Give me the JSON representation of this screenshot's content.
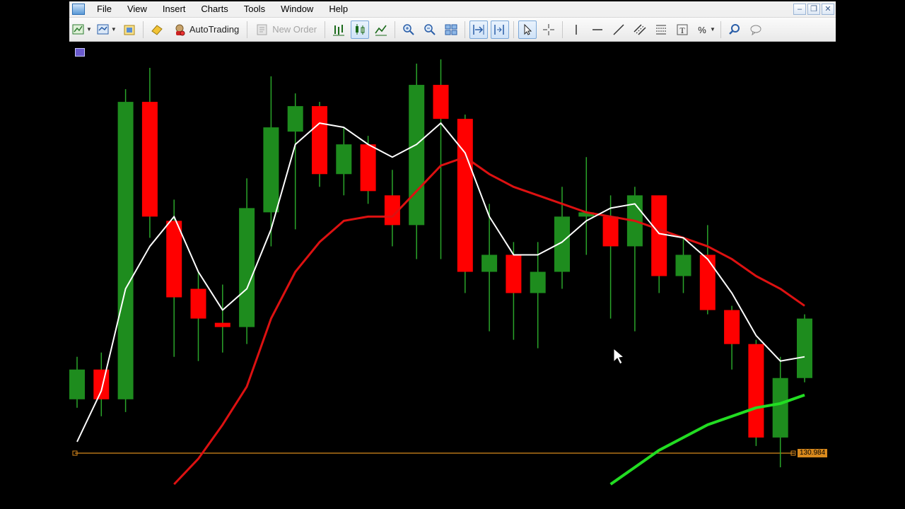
{
  "menu": {
    "items": [
      "File",
      "View",
      "Insert",
      "Charts",
      "Tools",
      "Window",
      "Help"
    ]
  },
  "window_controls": {
    "minimize": "–",
    "restore": "❐",
    "close": "✕"
  },
  "toolbar": {
    "autotrading_label": "AutoTrading",
    "new_order_label": "New Order"
  },
  "chart": {
    "price_label": "130.984",
    "colors": {
      "background": "#000000",
      "bull_candle": "#1e8c1e",
      "bear_candle": "#ff0000",
      "wick": "#2aa52a",
      "fast_ma": "#ffffff",
      "slow_ma": "#dd1111",
      "long_ma": "#22dd22",
      "horizontal_line": "#d8891d"
    }
  },
  "chart_data": {
    "type": "candlestick",
    "price_line": 130.984,
    "candles": [
      {
        "dir": "up",
        "o": 0.2,
        "c": 0.27,
        "h": 0.3,
        "l": 0.18
      },
      {
        "dir": "down",
        "o": 0.27,
        "c": 0.2,
        "h": 0.31,
        "l": 0.16
      },
      {
        "dir": "up",
        "o": 0.2,
        "c": 0.9,
        "h": 0.93,
        "l": 0.17
      },
      {
        "dir": "down",
        "o": 0.9,
        "c": 0.63,
        "h": 0.98,
        "l": 0.58
      },
      {
        "dir": "down",
        "o": 0.62,
        "c": 0.44,
        "h": 0.67,
        "l": 0.3
      },
      {
        "dir": "down",
        "o": 0.46,
        "c": 0.39,
        "h": 0.5,
        "l": 0.29
      },
      {
        "dir": "down",
        "o": 0.38,
        "c": 0.37,
        "h": 0.47,
        "l": 0.31
      },
      {
        "dir": "up",
        "o": 0.37,
        "c": 0.65,
        "h": 0.72,
        "l": 0.33
      },
      {
        "dir": "up",
        "o": 0.64,
        "c": 0.84,
        "h": 0.96,
        "l": 0.56
      },
      {
        "dir": "up",
        "o": 0.83,
        "c": 0.89,
        "h": 0.92,
        "l": 0.6
      },
      {
        "dir": "down",
        "o": 0.89,
        "c": 0.73,
        "h": 0.9,
        "l": 0.7
      },
      {
        "dir": "up",
        "o": 0.73,
        "c": 0.8,
        "h": 0.84,
        "l": 0.68
      },
      {
        "dir": "down",
        "o": 0.8,
        "c": 0.69,
        "h": 0.82,
        "l": 0.66
      },
      {
        "dir": "down",
        "o": 0.68,
        "c": 0.61,
        "h": 0.74,
        "l": 0.56
      },
      {
        "dir": "up",
        "o": 0.61,
        "c": 0.94,
        "h": 0.99,
        "l": 0.53
      },
      {
        "dir": "down",
        "o": 0.94,
        "c": 0.86,
        "h": 1.0,
        "l": 0.53
      },
      {
        "dir": "down",
        "o": 0.86,
        "c": 0.5,
        "h": 0.87,
        "l": 0.45
      },
      {
        "dir": "up",
        "o": 0.5,
        "c": 0.54,
        "h": 0.66,
        "l": 0.36
      },
      {
        "dir": "down",
        "o": 0.54,
        "c": 0.45,
        "h": 0.57,
        "l": 0.34
      },
      {
        "dir": "up",
        "o": 0.45,
        "c": 0.5,
        "h": 0.57,
        "l": 0.32
      },
      {
        "dir": "up",
        "o": 0.5,
        "c": 0.63,
        "h": 0.7,
        "l": 0.46
      },
      {
        "dir": "up",
        "o": 0.63,
        "c": 0.64,
        "h": 0.77,
        "l": 0.54
      },
      {
        "dir": "down",
        "o": 0.63,
        "c": 0.56,
        "h": 0.68,
        "l": 0.39
      },
      {
        "dir": "up",
        "o": 0.56,
        "c": 0.68,
        "h": 0.7,
        "l": 0.36
      },
      {
        "dir": "down",
        "o": 0.68,
        "c": 0.49,
        "h": 0.68,
        "l": 0.45
      },
      {
        "dir": "up",
        "o": 0.49,
        "c": 0.54,
        "h": 0.58,
        "l": 0.45
      },
      {
        "dir": "down",
        "o": 0.54,
        "c": 0.41,
        "h": 0.61,
        "l": 0.4
      },
      {
        "dir": "down",
        "o": 0.41,
        "c": 0.33,
        "h": 0.42,
        "l": 0.27
      },
      {
        "dir": "down",
        "o": 0.33,
        "c": 0.11,
        "h": 0.34,
        "l": 0.09
      },
      {
        "dir": "up",
        "o": 0.11,
        "c": 0.25,
        "h": 0.3,
        "l": 0.04
      },
      {
        "dir": "up",
        "o": 0.25,
        "c": 0.39,
        "h": 0.4,
        "l": 0.24
      }
    ],
    "fast_ma": [
      0.1,
      0.22,
      0.46,
      0.56,
      0.63,
      0.5,
      0.41,
      0.46,
      0.6,
      0.8,
      0.85,
      0.84,
      0.8,
      0.77,
      0.8,
      0.85,
      0.78,
      0.63,
      0.54,
      0.54,
      0.57,
      0.62,
      0.65,
      0.66,
      0.59,
      0.58,
      0.53,
      0.45,
      0.35,
      0.29,
      0.3
    ],
    "slow_ma": [
      null,
      null,
      null,
      null,
      0.0,
      0.06,
      0.14,
      0.23,
      0.39,
      0.5,
      0.57,
      0.62,
      0.63,
      0.63,
      0.69,
      0.75,
      0.77,
      0.73,
      0.7,
      0.68,
      0.66,
      0.64,
      0.63,
      0.62,
      0.6,
      0.58,
      0.56,
      0.53,
      0.49,
      0.46,
      0.42
    ],
    "long_ma": [
      null,
      null,
      null,
      null,
      null,
      null,
      null,
      null,
      null,
      null,
      null,
      null,
      null,
      null,
      null,
      null,
      null,
      null,
      null,
      null,
      null,
      null,
      0.0,
      0.04,
      0.08,
      0.11,
      0.14,
      0.16,
      0.18,
      0.19,
      0.21
    ]
  }
}
